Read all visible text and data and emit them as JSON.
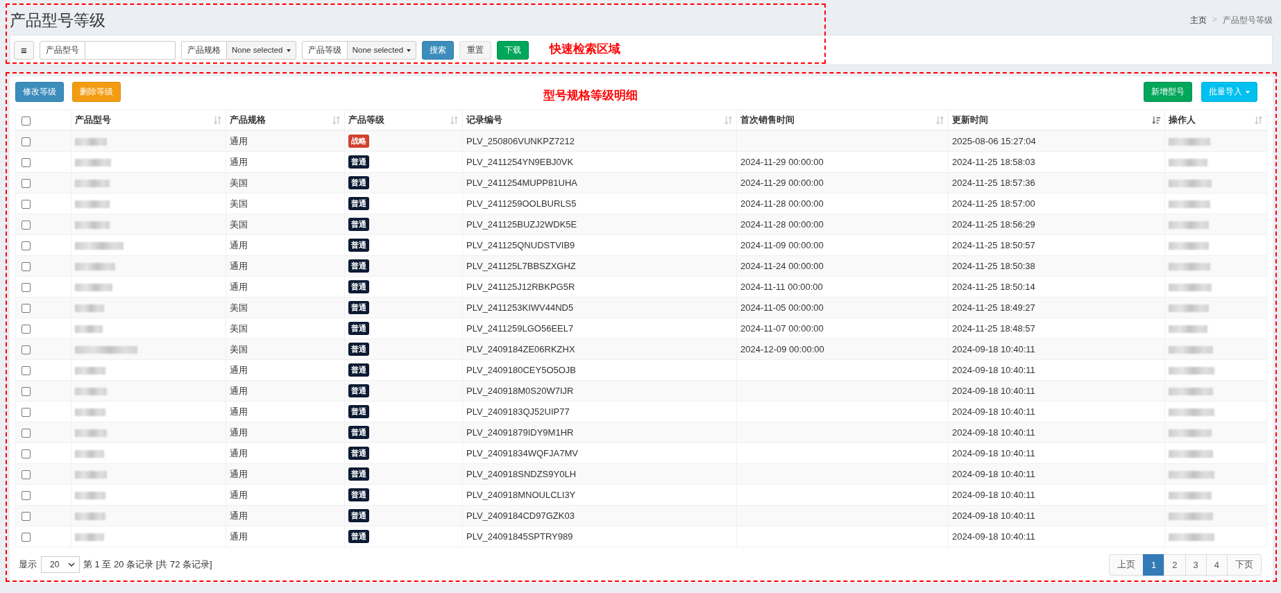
{
  "page_title": "产品型号等级",
  "breadcrumb": [
    {
      "label": "主页",
      "current": false
    },
    {
      "label": "产品型号等级",
      "current": true
    }
  ],
  "breadcrumb_separator": ">",
  "search_bar": {
    "menu_icon": "≡",
    "fields": [
      {
        "kind": "input",
        "label": "产品型号"
      },
      {
        "kind": "select",
        "label": "产品规格",
        "value": "None selected"
      },
      {
        "kind": "select",
        "label": "产品等级",
        "value": "None selected"
      }
    ],
    "buttons": [
      {
        "label": "搜索",
        "kind": "primary"
      },
      {
        "label": "重置",
        "kind": "default"
      },
      {
        "label": "下载",
        "kind": "success"
      }
    ],
    "annotation": "快速检索区域"
  },
  "toolbar": {
    "left_buttons": [
      {
        "label": "修改等级",
        "kind": "primary"
      },
      {
        "label": "删除等级",
        "kind": "warning"
      }
    ],
    "right_buttons": [
      {
        "label": "新增型号",
        "kind": "success",
        "dropdown": false
      },
      {
        "label": "批量导入",
        "kind": "info",
        "dropdown": true
      }
    ]
  },
  "table": {
    "annotation": "型号规格等级明细",
    "select_all": {
      "checked": false
    },
    "columns": [
      {
        "label": "产品型号",
        "sorted_desc": false
      },
      {
        "label": "产品规格",
        "sorted_desc": false
      },
      {
        "label": "产品等级",
        "sorted_desc": false
      },
      {
        "label": "记录编号",
        "sorted_desc": false
      },
      {
        "label": "首次销售时间",
        "sorted_desc": false
      },
      {
        "label": "更新时间",
        "sorted_desc": true
      },
      {
        "label": "操作人",
        "sorted_desc": false
      }
    ],
    "rows": [
      {
        "checked": false,
        "spec": "通用",
        "grade": "战略",
        "color": "#d0402c",
        "record": "PLV_250806VUNKPZ7212",
        "updated": "2025-08-06 15:27:04"
      },
      {
        "checked": false,
        "spec": "通用",
        "grade": "普通",
        "color": "#0c1a33",
        "record": "PLV_2411254YN9EBJ0VK",
        "first_sale": "2024-11-29 00:00:00",
        "updated": "2024-11-25 18:58:03"
      },
      {
        "checked": false,
        "spec": "美国",
        "grade": "普通",
        "color": "#0c1a33",
        "record": "PLV_2411254MUPP81UHA",
        "first_sale": "2024-11-29 00:00:00",
        "updated": "2024-11-25 18:57:36"
      },
      {
        "checked": false,
        "spec": "美国",
        "grade": "普通",
        "color": "#0c1a33",
        "record": "PLV_2411259OOLBURLS5",
        "first_sale": "2024-11-28 00:00:00",
        "updated": "2024-11-25 18:57:00"
      },
      {
        "checked": false,
        "spec": "美国",
        "grade": "普通",
        "color": "#0c1a33",
        "record": "PLV_241125BUZJ2WDK5E",
        "first_sale": "2024-11-28 00:00:00",
        "updated": "2024-11-25 18:56:29"
      },
      {
        "checked": false,
        "spec": "通用",
        "grade": "普通",
        "color": "#0c1a33",
        "record": "PLV_241125QNUDSTVIB9",
        "first_sale": "2024-11-09 00:00:00",
        "updated": "2024-11-25 18:50:57"
      },
      {
        "checked": false,
        "spec": "通用",
        "grade": "普通",
        "color": "#0c1a33",
        "record": "PLV_241125L7BBSZXGHZ",
        "first_sale": "2024-11-24 00:00:00",
        "updated": "2024-11-25 18:50:38"
      },
      {
        "checked": false,
        "spec": "通用",
        "grade": "普通",
        "color": "#0c1a33",
        "record": "PLV_241125J12RBKPG5R",
        "first_sale": "2024-11-11 00:00:00",
        "updated": "2024-11-25 18:50:14"
      },
      {
        "checked": false,
        "spec": "美国",
        "grade": "普通",
        "color": "#0c1a33",
        "record": "PLV_2411253KIWV44ND5",
        "first_sale": "2024-11-05 00:00:00",
        "updated": "2024-11-25 18:49:27"
      },
      {
        "checked": false,
        "spec": "美国",
        "grade": "普通",
        "color": "#0c1a33",
        "record": "PLV_2411259LGO56EEL7",
        "first_sale": "2024-11-07 00:00:00",
        "updated": "2024-11-25 18:48:57"
      },
      {
        "checked": false,
        "spec": "美国",
        "grade": "普通",
        "color": "#0c1a33",
        "record": "PLV_2409184ZE06RKZHX",
        "first_sale": "2024-12-09 00:00:00",
        "updated": "2024-09-18 10:40:11"
      },
      {
        "checked": false,
        "spec": "通用",
        "grade": "普通",
        "color": "#0c1a33",
        "record": "PLV_2409180CEY5O5OJB",
        "updated": "2024-09-18 10:40:11"
      },
      {
        "checked": false,
        "spec": "通用",
        "grade": "普通",
        "color": "#0c1a33",
        "record": "PLV_240918M0S20W7IJR",
        "updated": "2024-09-18 10:40:11"
      },
      {
        "checked": false,
        "spec": "通用",
        "grade": "普通",
        "color": "#0c1a33",
        "record": "PLV_2409183QJ52UIP77",
        "updated": "2024-09-18 10:40:11"
      },
      {
        "checked": false,
        "spec": "通用",
        "grade": "普通",
        "color": "#0c1a33",
        "record": "PLV_24091879IDY9M1HR",
        "updated": "2024-09-18 10:40:11"
      },
      {
        "checked": false,
        "spec": "通用",
        "grade": "普通",
        "color": "#0c1a33",
        "record": "PLV_24091834WQFJA7MV",
        "updated": "2024-09-18 10:40:11"
      },
      {
        "checked": false,
        "spec": "通用",
        "grade": "普通",
        "color": "#0c1a33",
        "record": "PLV_240918SNDZS9Y0LH",
        "updated": "2024-09-18 10:40:11"
      },
      {
        "checked": false,
        "spec": "通用",
        "grade": "普通",
        "color": "#0c1a33",
        "record": "PLV_240918MNOULCLI3Y",
        "updated": "2024-09-18 10:40:11"
      },
      {
        "checked": false,
        "spec": "通用",
        "grade": "普通",
        "color": "#0c1a33",
        "record": "PLV_2409184CD97GZK03",
        "updated": "2024-09-18 10:40:11"
      },
      {
        "checked": false,
        "spec": "通用",
        "grade": "普通",
        "color": "#0c1a33",
        "record": "PLV_24091845SPTRY989",
        "updated": "2024-09-18 10:40:11"
      }
    ]
  },
  "footer": {
    "show_label": "显示",
    "page_size": "20",
    "summary": "第 1 至 20 条记录 [共 72 条记录]",
    "pagination": [
      {
        "label": "上页",
        "selected": false
      },
      {
        "label": "1",
        "selected": true
      },
      {
        "label": "2",
        "selected": false
      },
      {
        "label": "3",
        "selected": false
      },
      {
        "label": "4",
        "selected": false
      },
      {
        "label": "下页",
        "selected": false
      }
    ]
  }
}
